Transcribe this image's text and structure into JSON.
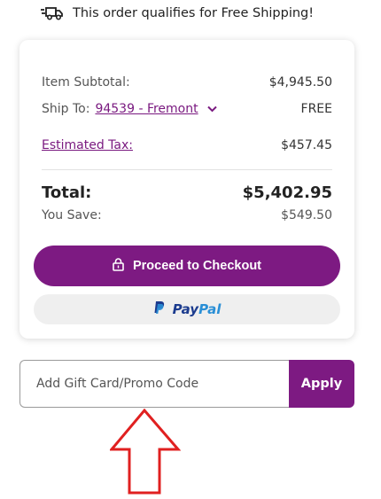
{
  "shipping_banner": {
    "icon": "truck-icon",
    "text": "This order qualifies for Free Shipping!"
  },
  "summary": {
    "subtotal_label": "Item Subtotal:",
    "subtotal_value": "$4,945.50",
    "ship_to_label": "Ship To:",
    "ship_to_location": "94539 - Fremont",
    "ship_value": "FREE",
    "tax_label": "Estimated Tax:",
    "tax_value": "$457.45",
    "total_label": "Total:",
    "total_value": "$5,402.95",
    "save_label": "You Save:",
    "save_value": "$549.50"
  },
  "checkout": {
    "label": "Proceed to Checkout",
    "icon": "lock-icon"
  },
  "paypal": {
    "pay": "Pay",
    "pal": "Pal",
    "icon": "paypal-icon"
  },
  "promo": {
    "placeholder": "Add Gift Card/Promo Code",
    "apply_label": "Apply"
  },
  "colors": {
    "accent": "#7d1a82",
    "link": "#7a1a80",
    "annotation_arrow": "#e02020",
    "paypal_dark": "#1b3b8e",
    "paypal_light": "#2a8fd6"
  }
}
